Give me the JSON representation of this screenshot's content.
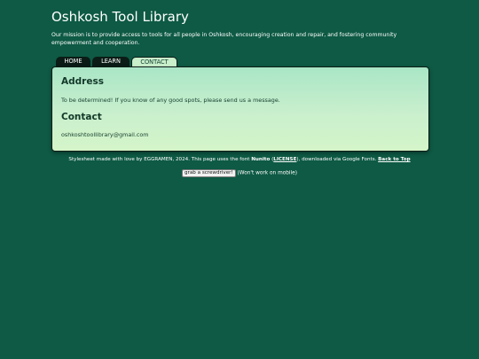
{
  "site": {
    "title": "Oshkosh Tool Library",
    "mission": "Our mission is to provide access to tools for all people in Oshkosh, encouraging creation and repair, and fostering community empowerment and cooperation."
  },
  "tabs": [
    {
      "label": "HOME",
      "active": false
    },
    {
      "label": "LEARN",
      "active": false
    },
    {
      "label": "CONTACT",
      "active": true
    }
  ],
  "panel": {
    "address_heading": "Address",
    "address_text": "To be determined! If you know of any good spots, please send us a message.",
    "contact_heading": "Contact",
    "contact_email": "oshkoshtoollibrary@gmail.com"
  },
  "footer": {
    "text_before": "Stylesheet made with love by EGGRAMEN, 2024. This page uses the font ",
    "font_name": "Nunito",
    "paren_open": " (",
    "license_link": "LICENSE",
    "text_after": "), downloaded via Google Fonts. ",
    "back_to_top": "Back to Top"
  },
  "screwdriver": {
    "button_label": "grab a screwdriver!",
    "note": "(Won't work on mobile)"
  },
  "colors": {
    "background": "#0e5a44",
    "panel_gradient_top": "#a9e6c6",
    "panel_gradient_bottom": "#d5f5c9",
    "tab_inactive": "#0b1c16",
    "tab_active": "#c9efcb"
  }
}
